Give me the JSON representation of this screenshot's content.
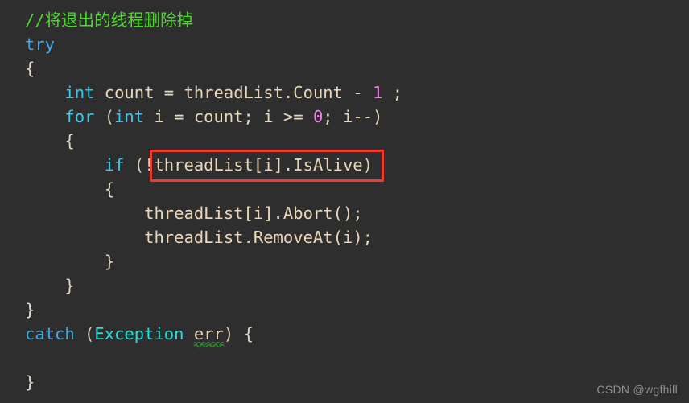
{
  "editor": {
    "background_color": "#2e2e2e",
    "font_size_px": 20.5,
    "line_height_px": 30,
    "language": "csharp"
  },
  "colors": {
    "comment": "#4BD82B",
    "keyword": "#3EA9E8",
    "keyword_alt": "#35C9F0",
    "type": "#1CE0DC",
    "identifier": "#ECE2CE",
    "number": "#F07FE8",
    "punctuation": "#E3D9C6",
    "highlight_box": "#F03A2E",
    "squiggle": "#2E8B2E",
    "watermark": "#8E8E8E"
  },
  "code": {
    "line_01": {
      "comment": "//将退出的线程删除掉"
    },
    "line_02": {
      "keyword": "try"
    },
    "line_03": {
      "brace": "{"
    },
    "line_04": {
      "indent": "    ",
      "keyword": "int",
      "sp1": " ",
      "name": "count",
      "op": " = ",
      "expr": "threadList.Count",
      "minus": " - ",
      "number": "1",
      "semi": " ;"
    },
    "line_05": {
      "indent": "    ",
      "keyword": "for",
      "open": " (",
      "kw_int": "int",
      "init": " i = count; i >= ",
      "number": "0",
      "tail": "; i--)"
    },
    "line_06": {
      "indent": "    ",
      "brace": "{"
    },
    "line_07": {
      "indent": "        ",
      "keyword": "if",
      "open": " (",
      "condition": "!threadList[i].IsAlive",
      "close": ")"
    },
    "line_08": {
      "indent": "        ",
      "brace": "{"
    },
    "line_09": {
      "indent": "            ",
      "stmt": "threadList[i].Abort();"
    },
    "line_10": {
      "indent": "            ",
      "stmt": "threadList.RemoveAt(i);"
    },
    "line_11": {
      "indent": "        ",
      "brace": "}"
    },
    "line_12": {
      "indent": "    ",
      "brace": "}"
    },
    "line_13": {
      "brace": "}"
    },
    "line_14": {
      "keyword": "catch",
      "open": " (",
      "type": "Exception",
      "sp": " ",
      "param": "err",
      "close": ") ",
      "brace": "{"
    },
    "line_15": {
      "blank": ""
    },
    "line_16": {
      "brace": "}"
    }
  },
  "annotations": {
    "highlight_target": "!threadList[i].IsAlive"
  },
  "watermark": {
    "text": "CSDN @wgfhill"
  }
}
